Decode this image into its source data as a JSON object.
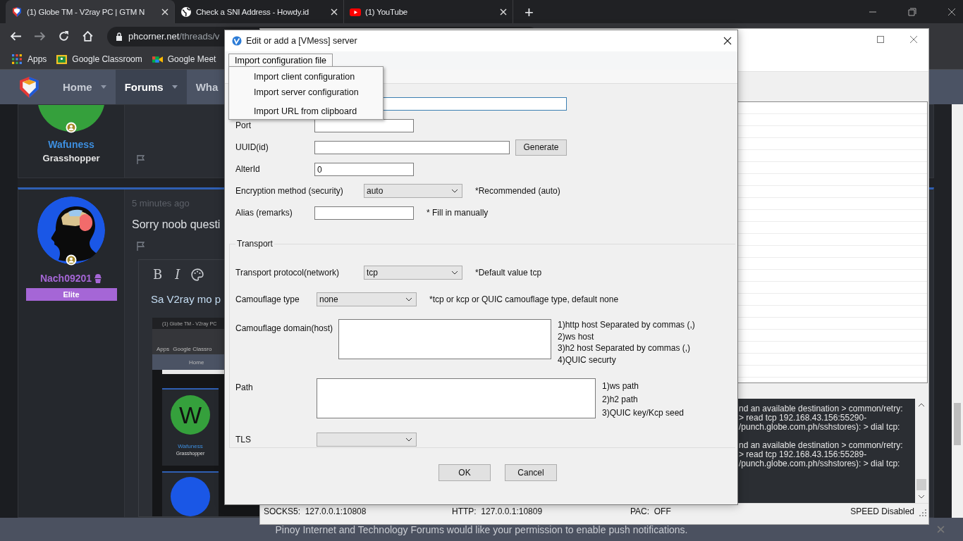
{
  "browser": {
    "tabs": [
      {
        "title": "(1) Globe TM - V2ray PC | GTM N",
        "selected": true
      },
      {
        "title": "Check a SNI Address - Howdy.id",
        "selected": false
      },
      {
        "title": "(1) YouTube",
        "selected": false
      }
    ],
    "new_tab": "+",
    "url": {
      "host": "phcorner.net",
      "path": "/threads/v"
    },
    "bookmarks": [
      {
        "label": "Apps"
      },
      {
        "label": "Google Classroom"
      },
      {
        "label": "Google Meet"
      }
    ]
  },
  "forum": {
    "nav": [
      {
        "label": "Home",
        "selected": false
      },
      {
        "label": "Forums",
        "selected": true
      },
      {
        "label": "Wha",
        "selected": false
      }
    ],
    "posts": [
      {
        "kind": "letter",
        "username": "Wafuness",
        "color": "#3d8fe0",
        "rank": "Grasshopper"
      },
      {
        "kind": "silhouette",
        "username": "Nach09201",
        "color": "#a566d6",
        "badge": "Elite",
        "time": "5 minutes ago",
        "text": "Sorry noob questi"
      }
    ],
    "editor": {
      "tools": [
        "B",
        "I"
      ],
      "text": "Sa V2ray mo p"
    },
    "embedded": {
      "tab": "(1) Globe TM - V2ray PC",
      "bookmarks": [
        "Apps",
        "Google Classro"
      ],
      "nav": "Home",
      "avatar_letter": "W",
      "username": "Wafuness",
      "rank": "Grasshopper"
    }
  },
  "notification": "Pinoy Internet and Technology Forums would like your permission to enable push notifications.",
  "v2ray": {
    "log": [
      [
        "nd an available destination > common/retry:",
        "> read tcp 192.168.43.156:55290-",
        "/punch.globe.com.ph/sshstores):  > dial tcp:"
      ],
      [
        "nd an available destination > common/retry:",
        "> read tcp 192.168.43.156:55289-",
        "/punch.globe.com.ph/sshstores):  > dial tcp:"
      ]
    ],
    "status": [
      {
        "label": "SOCKS5:",
        "value": "127.0.0.1:10808"
      },
      {
        "label": "HTTP:",
        "value": "127.0.0.1:10809"
      },
      {
        "label": "PAC:",
        "value": "OFF"
      }
    ],
    "speed": "SPEED Disabled"
  },
  "dialog": {
    "title": "Edit or add a [VMess] server",
    "menu": {
      "label": "Import configuration file",
      "expanded": true,
      "items": [
        {
          "label": "Import client configuration"
        },
        {
          "label": "Import server configuration"
        },
        {
          "label": "Import URL from clipboard",
          "separator_before": true
        }
      ]
    },
    "server_fields": [
      {
        "kind": "text"
      },
      {
        "kind": "text",
        "label": "Port"
      },
      {
        "kind": "text",
        "label": "UUID(id)",
        "button": "Generate",
        "wide": true
      },
      {
        "kind": "text",
        "label": "AlterId",
        "value": "0"
      },
      {
        "kind": "select",
        "label": "Encryption method (security)",
        "value": "auto",
        "hint": "*Recommended (auto)"
      },
      {
        "kind": "text",
        "label": "Alias (remarks)",
        "hint": "* Fill in manually"
      }
    ],
    "transport": {
      "title": "Transport",
      "fields": [
        {
          "kind": "select",
          "label": "Transport protocol(network)",
          "value": "tcp",
          "hint": "*Default value tcp"
        },
        {
          "kind": "select",
          "label": "Camouflage type",
          "value": "none",
          "hint": "*tcp or kcp or QUIC camouflage type, default none"
        },
        {
          "kind": "textarea",
          "label": "Camouflage domain(host)",
          "hints": [
            "1)http host Separated by commas (,)",
            "2)ws host",
            "3)h2 host Separated by commas (,)",
            "4)QUIC securty"
          ]
        },
        {
          "kind": "textarea",
          "label": "Path",
          "hints": [
            "1)ws path",
            "2)h2 path",
            "3)QUIC key/Kcp seed"
          ]
        },
        {
          "kind": "select",
          "label": "TLS"
        }
      ]
    },
    "buttons": [
      "OK",
      "Cancel"
    ]
  }
}
